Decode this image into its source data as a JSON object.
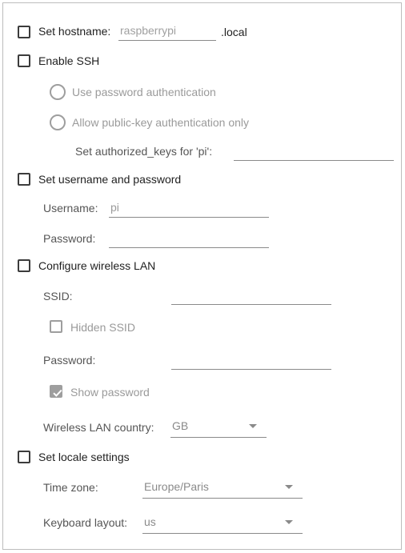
{
  "hostname": {
    "label": "Set hostname:",
    "placeholder": "raspberrypi",
    "suffix": ".local",
    "checked": false
  },
  "ssh": {
    "label": "Enable SSH",
    "password_auth": "Use password authentication",
    "pubkey_auth": "Allow public-key authentication only",
    "authorized_keys_label": "Set authorized_keys for 'pi':"
  },
  "user": {
    "label": "Set username and password",
    "username_label": "Username:",
    "username_value": "pi",
    "password_label": "Password:"
  },
  "wlan": {
    "label": "Configure wireless LAN",
    "ssid_label": "SSID:",
    "hidden_ssid": "Hidden SSID",
    "password_label": "Password:",
    "show_password": "Show password",
    "country_label": "Wireless LAN country:",
    "country_value": "GB"
  },
  "locale": {
    "label": "Set locale settings",
    "timezone_label": "Time zone:",
    "timezone_value": "Europe/Paris",
    "keyboard_label": "Keyboard layout:",
    "keyboard_value": "us"
  }
}
